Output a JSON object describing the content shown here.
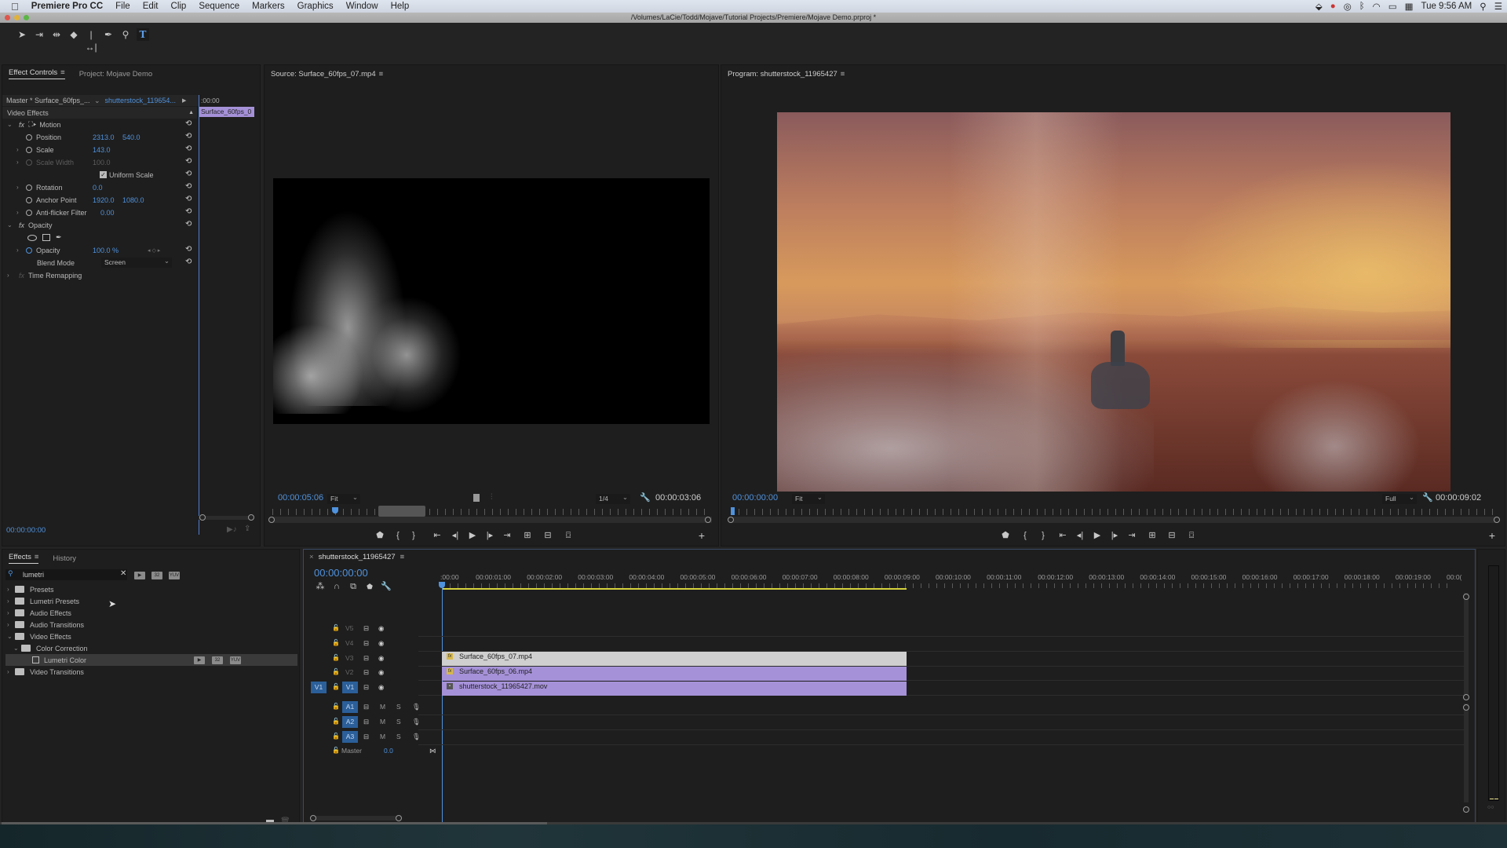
{
  "menubar": {
    "app_name": "Premiere Pro CC",
    "items": [
      "File",
      "Edit",
      "Clip",
      "Sequence",
      "Markers",
      "Graphics",
      "Window",
      "Help"
    ],
    "clock": "Tue 9:56 AM",
    "status_icons": [
      "dropbox-icon",
      "creative-cloud-icon",
      "screen-record-icon",
      "bluetooth-icon",
      "wifi-icon",
      "airplay-icon",
      "calendar-icon",
      "spotlight-search-icon",
      "notification-center-icon"
    ]
  },
  "window": {
    "title": "/Volumes/LaCie/Todd/Mojave/Tutorial Projects/Premiere/Mojave Demo.prproj *"
  },
  "tools": [
    "selection-tool",
    "track-select-tool",
    "ripple-edit-tool",
    "razor-tool",
    "slip-tool",
    "pen-tool",
    "zoom-tool",
    "type-tool"
  ],
  "effect_controls": {
    "tabs": [
      "Effect Controls",
      "Project: Mojave Demo"
    ],
    "master_label": "Master * Surface_60fps_...",
    "clip_label": "shutterstock_119654...",
    "mini_timeline_time": ":00:00",
    "mini_clip_label": "Surface_60fps_0",
    "section": "Video Effects",
    "motion": {
      "label": "Motion",
      "position_label": "Position",
      "position_x": "2313.0",
      "position_y": "540.0",
      "scale_label": "Scale",
      "scale": "143.0",
      "scale_width_label": "Scale Width",
      "scale_width": "100.0",
      "uniform_scale_label": "Uniform Scale",
      "uniform_scale_checked": true,
      "rotation_label": "Rotation",
      "rotation": "0.0",
      "anchor_label": "Anchor Point",
      "anchor_x": "1920.0",
      "anchor_y": "1080.0",
      "antiflicker_label": "Anti-flicker Filter",
      "antiflicker": "0.00"
    },
    "opacity": {
      "label": "Opacity",
      "opacity_label": "Opacity",
      "opacity_value": "100.0 %",
      "blend_label": "Blend Mode",
      "blend_value": "Screen"
    },
    "time_remapping_label": "Time Remapping",
    "timecode": "00:00:00:00"
  },
  "source_monitor": {
    "title": "Source: Surface_60fps_07.mp4",
    "timecode": "00:00:05:06",
    "zoom": "Fit",
    "resolution": "1/4",
    "duration": "00:00:03:06",
    "playhead_fraction": 0.05
  },
  "program_monitor": {
    "title": "Program: shutterstock_11965427",
    "timecode": "00:00:00:00",
    "zoom": "Fit",
    "resolution": "Full",
    "duration": "00:00:09:02",
    "playhead_fraction": 0.0
  },
  "transport_controls": [
    "add-marker",
    "mark-in",
    "mark-out",
    "go-to-in",
    "step-back",
    "play",
    "step-forward",
    "go-to-out",
    "insert",
    "overwrite",
    "export-frame"
  ],
  "effects_panel": {
    "tabs": [
      "Effects",
      "History"
    ],
    "search_value": "lumetri",
    "badges": [
      "32",
      "YUV"
    ],
    "tree": [
      {
        "label": "Presets",
        "level": 0,
        "expanded": false,
        "special": true
      },
      {
        "label": "Lumetri Presets",
        "level": 0,
        "expanded": false,
        "special": true
      },
      {
        "label": "Audio Effects",
        "level": 0,
        "expanded": false
      },
      {
        "label": "Audio Transitions",
        "level": 0,
        "expanded": false
      },
      {
        "label": "Video Effects",
        "level": 0,
        "expanded": true
      },
      {
        "label": "Color Correction",
        "level": 1,
        "expanded": true
      },
      {
        "label": "Lumetri Color",
        "level": 2,
        "selected": true,
        "effect": true
      },
      {
        "label": "Video Transitions",
        "level": 0,
        "expanded": false
      }
    ]
  },
  "timeline": {
    "sequence_name": "shutterstock_11965427",
    "timecode": "00:00:00:00",
    "ruler": [
      ":00:00",
      "00:00:01:00",
      "00:00:02:00",
      "00:00:03:00",
      "00:00:04:00",
      "00:00:05:00",
      "00:00:06:00",
      "00:00:07:00",
      "00:00:08:00",
      "00:00:09:00",
      "00:00:10:00",
      "00:00:11:00",
      "00:00:12:00",
      "00:00:13:00",
      "00:00:14:00",
      "00:00:15:00",
      "00:00:16:00",
      "00:00:17:00",
      "00:00:18:00",
      "00:00:19:00",
      "00:0("
    ],
    "video_tracks": [
      "V5",
      "V4",
      "V3",
      "V2",
      "V1"
    ],
    "audio_tracks": [
      "A1",
      "A2",
      "A3"
    ],
    "source_patch": "V1",
    "mute_label": "M",
    "solo_label": "S",
    "master_label": "Master",
    "master_value": "0.0",
    "clips": [
      {
        "name": "Surface_60fps_07.mp4",
        "track": "V3",
        "start_sec": 0,
        "end_sec": 9.1,
        "color": "#cfcfcf",
        "fx": true
      },
      {
        "name": "Surface_60fps_06.mp4",
        "track": "V2",
        "start_sec": 0,
        "end_sec": 9.1,
        "color": "#a591d8",
        "fx": true
      },
      {
        "name": "shutterstock_11965427.mov",
        "track": "V1",
        "start_sec": 0,
        "end_sec": 9.1,
        "color": "#a591d8",
        "fx": false
      }
    ]
  },
  "colors": {
    "accent_blue": "#4f92dd",
    "clip_purple": "#a591d8",
    "clip_gray": "#cfcfcf",
    "work_area_yellow": "#d6d23c"
  }
}
